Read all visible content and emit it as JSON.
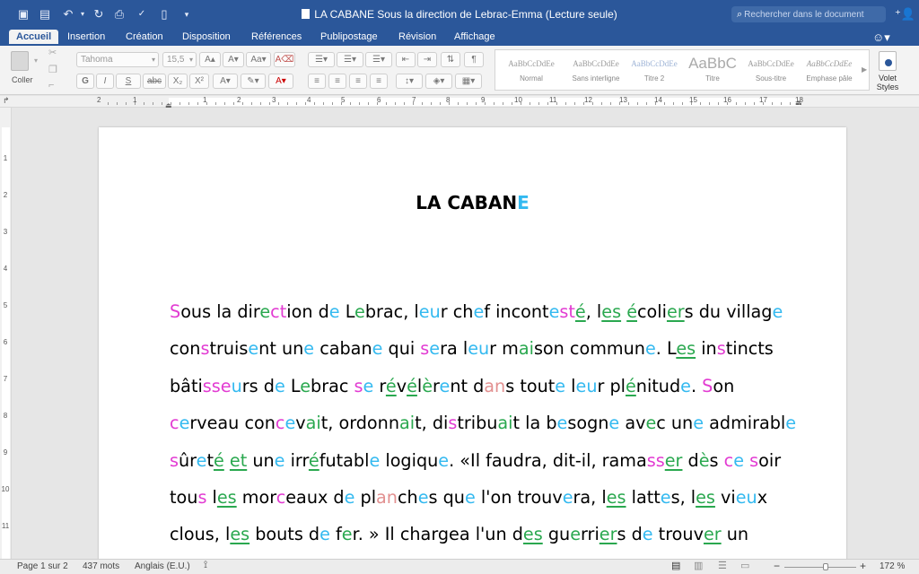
{
  "window": {
    "title": "LA CABANE Sous la direction de Lebrac-Emma (Lecture seule)",
    "search_placeholder": "Rechercher dans le document"
  },
  "tabs": [
    "Accueil",
    "Insertion",
    "Création",
    "Disposition",
    "Références",
    "Publipostage",
    "Révision",
    "Affichage"
  ],
  "ribbon": {
    "paste_label": "Coller",
    "font_name": "Tahoma",
    "font_size": "15,5",
    "bold": "G",
    "italic": "I",
    "underline": "S",
    "strike": "abc",
    "subscript": "X₂",
    "superscript": "X²",
    "styles": [
      {
        "preview": "AaBbCcDdEe",
        "name": "Normal"
      },
      {
        "preview": "AaBbCcDdEe",
        "name": "Sans interligne"
      },
      {
        "preview": "AaBbCcDdEe",
        "name": "Titre 2"
      },
      {
        "preview": "AaBbC",
        "name": "Titre"
      },
      {
        "preview": "AaBbCcDdEe",
        "name": "Sous-titre"
      },
      {
        "preview": "AaBbCcDdEe",
        "name": "Emphase pâle"
      }
    ],
    "volet_line1": "Volet",
    "volet_line2": "Styles"
  },
  "ruler": {
    "h_numbers": [
      "2",
      "1",
      "1",
      "2",
      "3",
      "4",
      "5",
      "6",
      "7",
      "8",
      "9",
      "10",
      "11",
      "12",
      "13",
      "14",
      "15",
      "16",
      "17",
      "18"
    ],
    "v_numbers": [
      "1",
      "2",
      "3",
      "4",
      "5",
      "6",
      "7",
      "8",
      "9",
      "10",
      "11"
    ]
  },
  "document": {
    "heading_main": "LA CABAN",
    "heading_last": "E",
    "lines": [
      [
        [
          "Sous",
          "m",
          0,
          1
        ],
        [
          " la dir",
          null,
          0,
          0
        ],
        [
          "e",
          "g",
          0,
          0
        ],
        [
          "c",
          "m",
          0,
          0
        ],
        [
          "t",
          "m",
          0,
          0
        ],
        [
          "ion d",
          null,
          0,
          0
        ],
        [
          "e",
          "c",
          0,
          0
        ],
        [
          " L",
          null,
          0,
          0
        ],
        [
          "e",
          "g",
          0,
          0
        ],
        [
          "brac, l",
          null,
          0,
          0
        ],
        [
          "eu",
          "c",
          0,
          0
        ],
        [
          "r ch",
          null,
          0,
          0
        ],
        [
          "e",
          "c",
          0,
          0
        ],
        [
          "f incont",
          null,
          0,
          0
        ],
        [
          "e",
          "c",
          0,
          0
        ],
        [
          "st",
          "m",
          0,
          0
        ],
        [
          "é",
          "g",
          1,
          0
        ],
        [
          ", l",
          null,
          0,
          0
        ],
        [
          "es",
          "g",
          1,
          0
        ],
        [
          " ",
          null,
          0,
          0
        ],
        [
          "é",
          "g",
          1,
          0
        ],
        [
          "coli",
          null,
          0,
          0
        ],
        [
          "er",
          "g",
          1,
          0
        ],
        [
          "s du villag",
          null,
          0,
          0
        ],
        [
          "e",
          "c",
          0,
          0
        ]
      ],
      [
        [
          "con",
          null,
          0,
          0
        ],
        [
          "s",
          "m",
          0,
          0
        ],
        [
          "truis",
          null,
          0,
          0
        ],
        [
          "e",
          "c",
          0,
          0
        ],
        [
          "nt un",
          null,
          0,
          0
        ],
        [
          "e",
          "c",
          0,
          0
        ],
        [
          " caban",
          null,
          0,
          0
        ],
        [
          "e",
          "c",
          0,
          0
        ],
        [
          " qui ",
          null,
          0,
          0
        ],
        [
          "s",
          "m",
          0,
          0
        ],
        [
          "e",
          "c",
          0,
          0
        ],
        [
          "ra l",
          null,
          0,
          0
        ],
        [
          "eu",
          "c",
          0,
          0
        ],
        [
          "r m",
          null,
          0,
          0
        ],
        [
          "ai",
          "g",
          0,
          0
        ],
        [
          "son commun",
          null,
          0,
          0
        ],
        [
          "e",
          "c",
          0,
          0
        ],
        [
          ". L",
          null,
          0,
          0
        ],
        [
          "es",
          "g",
          1,
          0
        ],
        [
          " in",
          null,
          0,
          0
        ],
        [
          "s",
          "m",
          0,
          0
        ],
        [
          "tincts",
          null,
          0,
          0
        ]
      ],
      [
        [
          "bâti",
          null,
          0,
          0
        ],
        [
          "sse",
          "m",
          0,
          0
        ],
        [
          "u",
          "c",
          0,
          0
        ],
        [
          "rs d",
          null,
          0,
          0
        ],
        [
          "e",
          "c",
          0,
          0
        ],
        [
          " L",
          null,
          0,
          0
        ],
        [
          "e",
          "g",
          0,
          0
        ],
        [
          "brac ",
          null,
          0,
          0
        ],
        [
          "s",
          "m",
          0,
          0
        ],
        [
          "e",
          "c",
          0,
          0
        ],
        [
          " r",
          null,
          0,
          0
        ],
        [
          "é",
          "g",
          1,
          0
        ],
        [
          "v",
          null,
          0,
          0
        ],
        [
          "é",
          "g",
          1,
          0
        ],
        [
          "l",
          null,
          0,
          0
        ],
        [
          "è",
          "g",
          0,
          0
        ],
        [
          "r",
          null,
          0,
          0
        ],
        [
          "e",
          "c",
          0,
          0
        ],
        [
          "nt d",
          null,
          0,
          0
        ],
        [
          "an",
          "r",
          0,
          0
        ],
        [
          "s tout",
          null,
          0,
          0
        ],
        [
          "e",
          "c",
          0,
          0
        ],
        [
          " l",
          null,
          0,
          0
        ],
        [
          "eu",
          "c",
          0,
          0
        ],
        [
          "r pl",
          null,
          0,
          0
        ],
        [
          "é",
          "g",
          1,
          0
        ],
        [
          "nitud",
          null,
          0,
          0
        ],
        [
          "e",
          "c",
          0,
          0
        ],
        [
          ". ",
          null,
          0,
          0
        ],
        [
          "S",
          "m",
          0,
          0
        ],
        [
          "on",
          null,
          0,
          0
        ]
      ],
      [
        [
          "c",
          "m",
          0,
          0
        ],
        [
          "e",
          "c",
          0,
          0
        ],
        [
          "rveau con",
          null,
          0,
          0
        ],
        [
          "c",
          "m",
          0,
          0
        ],
        [
          "e",
          "c",
          0,
          0
        ],
        [
          "v",
          null,
          0,
          0
        ],
        [
          "ai",
          "g",
          0,
          0
        ],
        [
          "t, ordonn",
          null,
          0,
          0
        ],
        [
          "ai",
          "g",
          0,
          0
        ],
        [
          "t, di",
          null,
          0,
          0
        ],
        [
          "s",
          "m",
          0,
          0
        ],
        [
          "tribu",
          null,
          0,
          0
        ],
        [
          "ai",
          "g",
          0,
          0
        ],
        [
          "t la b",
          null,
          0,
          0
        ],
        [
          "e",
          "c",
          0,
          0
        ],
        [
          "sogn",
          null,
          0,
          0
        ],
        [
          "e",
          "c",
          0,
          0
        ],
        [
          " av",
          null,
          0,
          0
        ],
        [
          "e",
          "g",
          0,
          0
        ],
        [
          "c un",
          null,
          0,
          0
        ],
        [
          "e",
          "c",
          0,
          0
        ],
        [
          " admirabl",
          null,
          0,
          0
        ],
        [
          "e",
          "c",
          0,
          0
        ]
      ],
      [
        [
          "s",
          "m",
          0,
          0
        ],
        [
          "ûr",
          null,
          0,
          0
        ],
        [
          "e",
          "c",
          0,
          0
        ],
        [
          "t",
          null,
          0,
          0
        ],
        [
          "é",
          "g",
          1,
          0
        ],
        [
          " ",
          null,
          0,
          0
        ],
        [
          "et",
          "g",
          1,
          0
        ],
        [
          " un",
          null,
          0,
          0
        ],
        [
          "e",
          "c",
          0,
          0
        ],
        [
          " irr",
          null,
          0,
          0
        ],
        [
          "é",
          "g",
          1,
          0
        ],
        [
          "futabl",
          null,
          0,
          0
        ],
        [
          "e",
          "c",
          0,
          0
        ],
        [
          " logiqu",
          null,
          0,
          0
        ],
        [
          "e",
          "c",
          0,
          0
        ],
        [
          ". «Il faudra, dit-il, rama",
          null,
          0,
          0
        ],
        [
          "ss",
          "m",
          0,
          0
        ],
        [
          "er",
          "g",
          1,
          0
        ],
        [
          " d",
          null,
          0,
          0
        ],
        [
          "è",
          "g",
          0,
          0
        ],
        [
          "s ",
          null,
          0,
          0
        ],
        [
          "c",
          "m",
          0,
          0
        ],
        [
          "e",
          "c",
          0,
          0
        ],
        [
          " ",
          null,
          0,
          0
        ],
        [
          "s",
          "m",
          0,
          0
        ],
        [
          "oir",
          null,
          0,
          0
        ]
      ],
      [
        [
          "tou",
          null,
          0,
          0
        ],
        [
          "s",
          "m",
          0,
          0
        ],
        [
          " l",
          null,
          0,
          0
        ],
        [
          "es",
          "g",
          1,
          0
        ],
        [
          " mor",
          null,
          0,
          0
        ],
        [
          "c",
          "m",
          0,
          0
        ],
        [
          "eaux d",
          null,
          0,
          0
        ],
        [
          "e",
          "c",
          0,
          0
        ],
        [
          " pl",
          null,
          0,
          0
        ],
        [
          "an",
          "r",
          0,
          0
        ],
        [
          "ch",
          null,
          0,
          0
        ],
        [
          "e",
          "c",
          0,
          0
        ],
        [
          "s qu",
          null,
          0,
          0
        ],
        [
          "e",
          "c",
          0,
          0
        ],
        [
          " l'on trouv",
          null,
          0,
          0
        ],
        [
          "e",
          "c",
          0,
          0
        ],
        [
          "ra, l",
          null,
          0,
          0
        ],
        [
          "es",
          "g",
          1,
          0
        ],
        [
          " latt",
          null,
          0,
          0
        ],
        [
          "e",
          "c",
          0,
          0
        ],
        [
          "s, l",
          null,
          0,
          0
        ],
        [
          "es",
          "g",
          1,
          0
        ],
        [
          " vi",
          null,
          0,
          0
        ],
        [
          "eu",
          "c",
          0,
          0
        ],
        [
          "x",
          null,
          0,
          0
        ]
      ],
      [
        [
          "clous, l",
          null,
          0,
          0
        ],
        [
          "es",
          "g",
          1,
          0
        ],
        [
          " bouts d",
          null,
          0,
          0
        ],
        [
          "e",
          "c",
          0,
          0
        ],
        [
          " f",
          null,
          0,
          0
        ],
        [
          "e",
          "g",
          0,
          0
        ],
        [
          "r. » Il chargea l'un d",
          null,
          0,
          0
        ],
        [
          "es",
          "g",
          1,
          0
        ],
        [
          " gu",
          null,
          0,
          0
        ],
        [
          "e",
          "g",
          0,
          0
        ],
        [
          "rri",
          null,
          0,
          0
        ],
        [
          "er",
          "g",
          1,
          0
        ],
        [
          "s d",
          null,
          0,
          0
        ],
        [
          "e",
          "c",
          0,
          0
        ],
        [
          " trouv",
          null,
          0,
          0
        ],
        [
          "er",
          "g",
          1,
          0
        ],
        [
          " un",
          null,
          0,
          0
        ]
      ]
    ]
  },
  "status": {
    "page": "Page 1 sur 2",
    "words": "437 mots",
    "language": "Anglais (E.U.)",
    "zoom": "172 %"
  }
}
